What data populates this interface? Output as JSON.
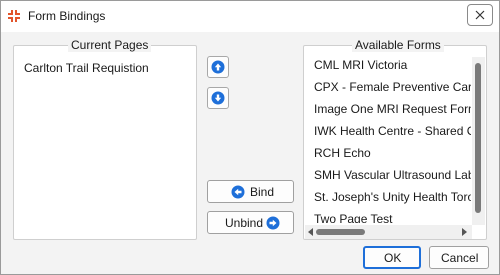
{
  "window": {
    "title": "Form Bindings",
    "close_glyph": "✕"
  },
  "current_pages": {
    "title": "Current Pages",
    "items": [
      "Carlton Trail Requistion"
    ]
  },
  "available_forms": {
    "title": "Available Forms",
    "items": [
      "CML MRI Victoria",
      "CPX - Female Preventive Care Checklist",
      "Image One MRI Request Form",
      "IWK Health Centre - Shared Care",
      "RCH Echo",
      "SMH Vascular Ultrasound Laboratory",
      "St. Joseph's Unity Health Toronto",
      "Two Page Test"
    ]
  },
  "buttons": {
    "move_up": "move-up-icon",
    "move_down": "move-down-icon",
    "bind": "Bind",
    "unbind": "Unbind",
    "ok": "OK",
    "cancel": "Cancel"
  },
  "colors": {
    "accent": "#1e6fd9",
    "icon_orange": "#e2552c"
  }
}
